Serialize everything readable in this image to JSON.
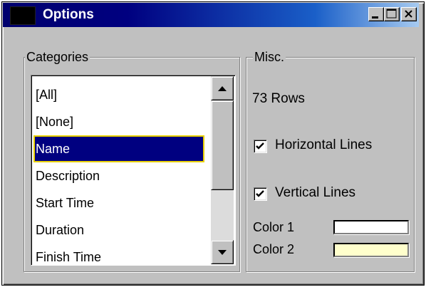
{
  "window": {
    "title": "Options",
    "title_bar_colors": [
      "#000080",
      "#a6caf0"
    ]
  },
  "categories": {
    "label": "Categories",
    "items": [
      {
        "label": "[All]"
      },
      {
        "label": "[None]"
      },
      {
        "label": "Name",
        "selected": true
      },
      {
        "label": "Description"
      },
      {
        "label": "Start Time"
      },
      {
        "label": "Duration"
      },
      {
        "label": "Finish Time"
      }
    ],
    "selection_colors": {
      "background": "#000080",
      "focus_border": "#e8d000"
    }
  },
  "misc": {
    "label": "Misc.",
    "rows_text": "73 Rows",
    "horizontal_lines": {
      "label": "Horizontal Lines",
      "checked": true
    },
    "vertical_lines": {
      "label": "Vertical Lines",
      "checked": true
    },
    "color1": {
      "label": "Color 1",
      "value": "#ffffff"
    },
    "color2": {
      "label": "Color 2",
      "value": "#ffffcc"
    }
  },
  "icons": {
    "minimize": "minimize-icon",
    "maximize": "maximize-icon",
    "close": "close-icon",
    "scroll_up": "arrow-up-icon",
    "scroll_down": "arrow-down-icon",
    "check": "checkmark-icon"
  }
}
